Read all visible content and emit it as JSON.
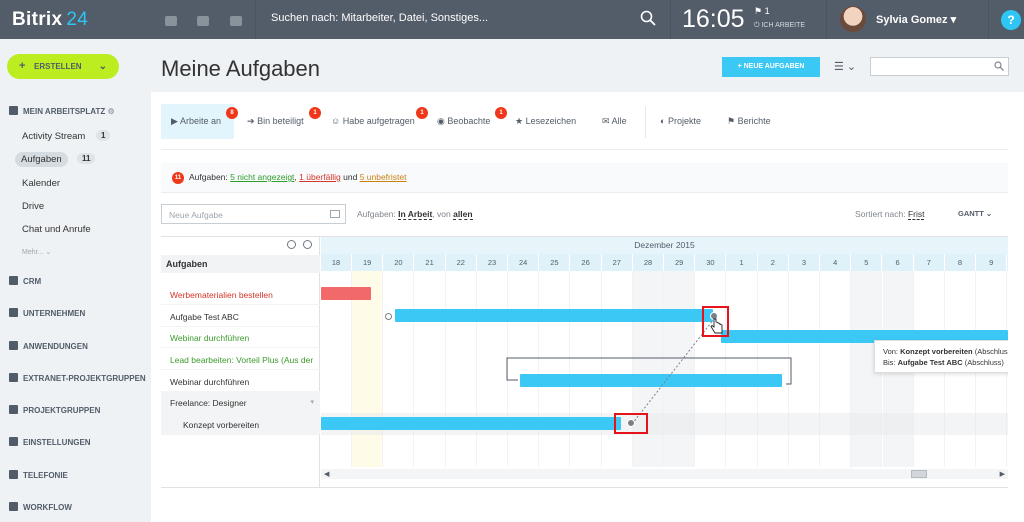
{
  "topbar": {
    "brand": "Bitrix",
    "brand_num": "24",
    "search_placeholder": "Suchen nach: Mitarbeiter, Datei, Sonstiges...",
    "clock": "16:05",
    "clock_flag": "⚑ 1",
    "clock_status": "⏻ ICH ARBEITE",
    "username": "Sylvia Gomez ▾",
    "help": "?"
  },
  "sidebar": {
    "create_label": "ERSTELLEN",
    "create_plus": "+",
    "create_chevron": "⌄",
    "workspace": "MEIN ARBEITSPLATZ",
    "items": [
      {
        "label": "Activity Stream",
        "badge": "1"
      },
      {
        "label": "Aufgaben",
        "badge": "11"
      },
      {
        "label": "Kalender"
      },
      {
        "label": "Drive"
      },
      {
        "label": "Chat und Anrufe"
      }
    ],
    "more": "Mehr... ⌄",
    "sections": [
      "CRM",
      "UNTERNEHMEN",
      "ANWENDUNGEN",
      "EXTRANET-PROJEKTGRUPPEN",
      "PROJEKTGRUPPEN",
      "EINSTELLUNGEN",
      "TELEFONIE",
      "WORKFLOW"
    ]
  },
  "header": {
    "title": "Meine Aufgaben",
    "new_task": "+ NEUE AUFGABEN",
    "view_toggle": "☰ ⌄"
  },
  "tabs": [
    {
      "label": "Arbeite an",
      "icon": "▶",
      "badge": "8"
    },
    {
      "label": "Bin beteiligt",
      "icon": "➔",
      "badge": "1"
    },
    {
      "label": "Habe aufgetragen",
      "icon": "☺",
      "badge": "1"
    },
    {
      "label": "Beobachte",
      "icon": "◉",
      "badge": "1"
    },
    {
      "label": "Lesezeichen",
      "icon": "★"
    },
    {
      "label": "Alle",
      "icon": "✉"
    },
    {
      "label": "Projekte",
      "icon": "◐"
    },
    {
      "label": "Berichte",
      "icon": "⚑"
    }
  ],
  "counter": {
    "count": "11",
    "prefix": "Aufgaben:",
    "not_shown": "5 nicht angezeigt",
    "overdue": "1 überfällig",
    "und": "und",
    "unlimited": "5 unbefristet"
  },
  "filters": {
    "quick_placeholder": "Neue Aufgabe",
    "tasks_label": "Aufgaben:",
    "status": "In Arbeit",
    "from_label": "von",
    "from_value": "allen",
    "sort_label": "Sortiert nach:",
    "sort_value": "Frist",
    "mode": "GANTT ⌄"
  },
  "gantt": {
    "tree_header": "Aufgaben",
    "month": "Dezember 2015",
    "days": [
      "18",
      "19",
      "20",
      "21",
      "22",
      "23",
      "24",
      "25",
      "26",
      "27",
      "28",
      "29",
      "30",
      "1",
      "2",
      "3",
      "4",
      "5",
      "6",
      "7",
      "8",
      "9"
    ],
    "rows": [
      {
        "label": "Werbematerialien bestellen",
        "color": "red"
      },
      {
        "label": "Aufgabe Test ABC",
        "color": "dark"
      },
      {
        "label": "Webinar durchführen",
        "color": "green"
      },
      {
        "label": "Lead bearbeiten: Vorteil Plus (Aus der",
        "color": "green"
      },
      {
        "label": "Webinar durchführen",
        "color": "dark"
      },
      {
        "label": "Freelance: Designer",
        "color": "group"
      },
      {
        "label": "Konzept vorbereiten",
        "color": "sub"
      }
    ],
    "tooltip": {
      "von_label": "Von:",
      "von_task": "Konzept vorbereiten",
      "von_suffix": "(Abschluss)",
      "bis_label": "Bis:",
      "bis_task": "Aufgabe Test ABC",
      "bis_suffix": "(Abschluss)"
    },
    "scroll_left": "◀",
    "scroll_right": "▶"
  },
  "colors": {
    "accent": "#3bc8f5",
    "create": "#bbed21",
    "badge": "#f0371b",
    "overdue_bar": "#f2696a",
    "highlight": "#e6131c"
  }
}
